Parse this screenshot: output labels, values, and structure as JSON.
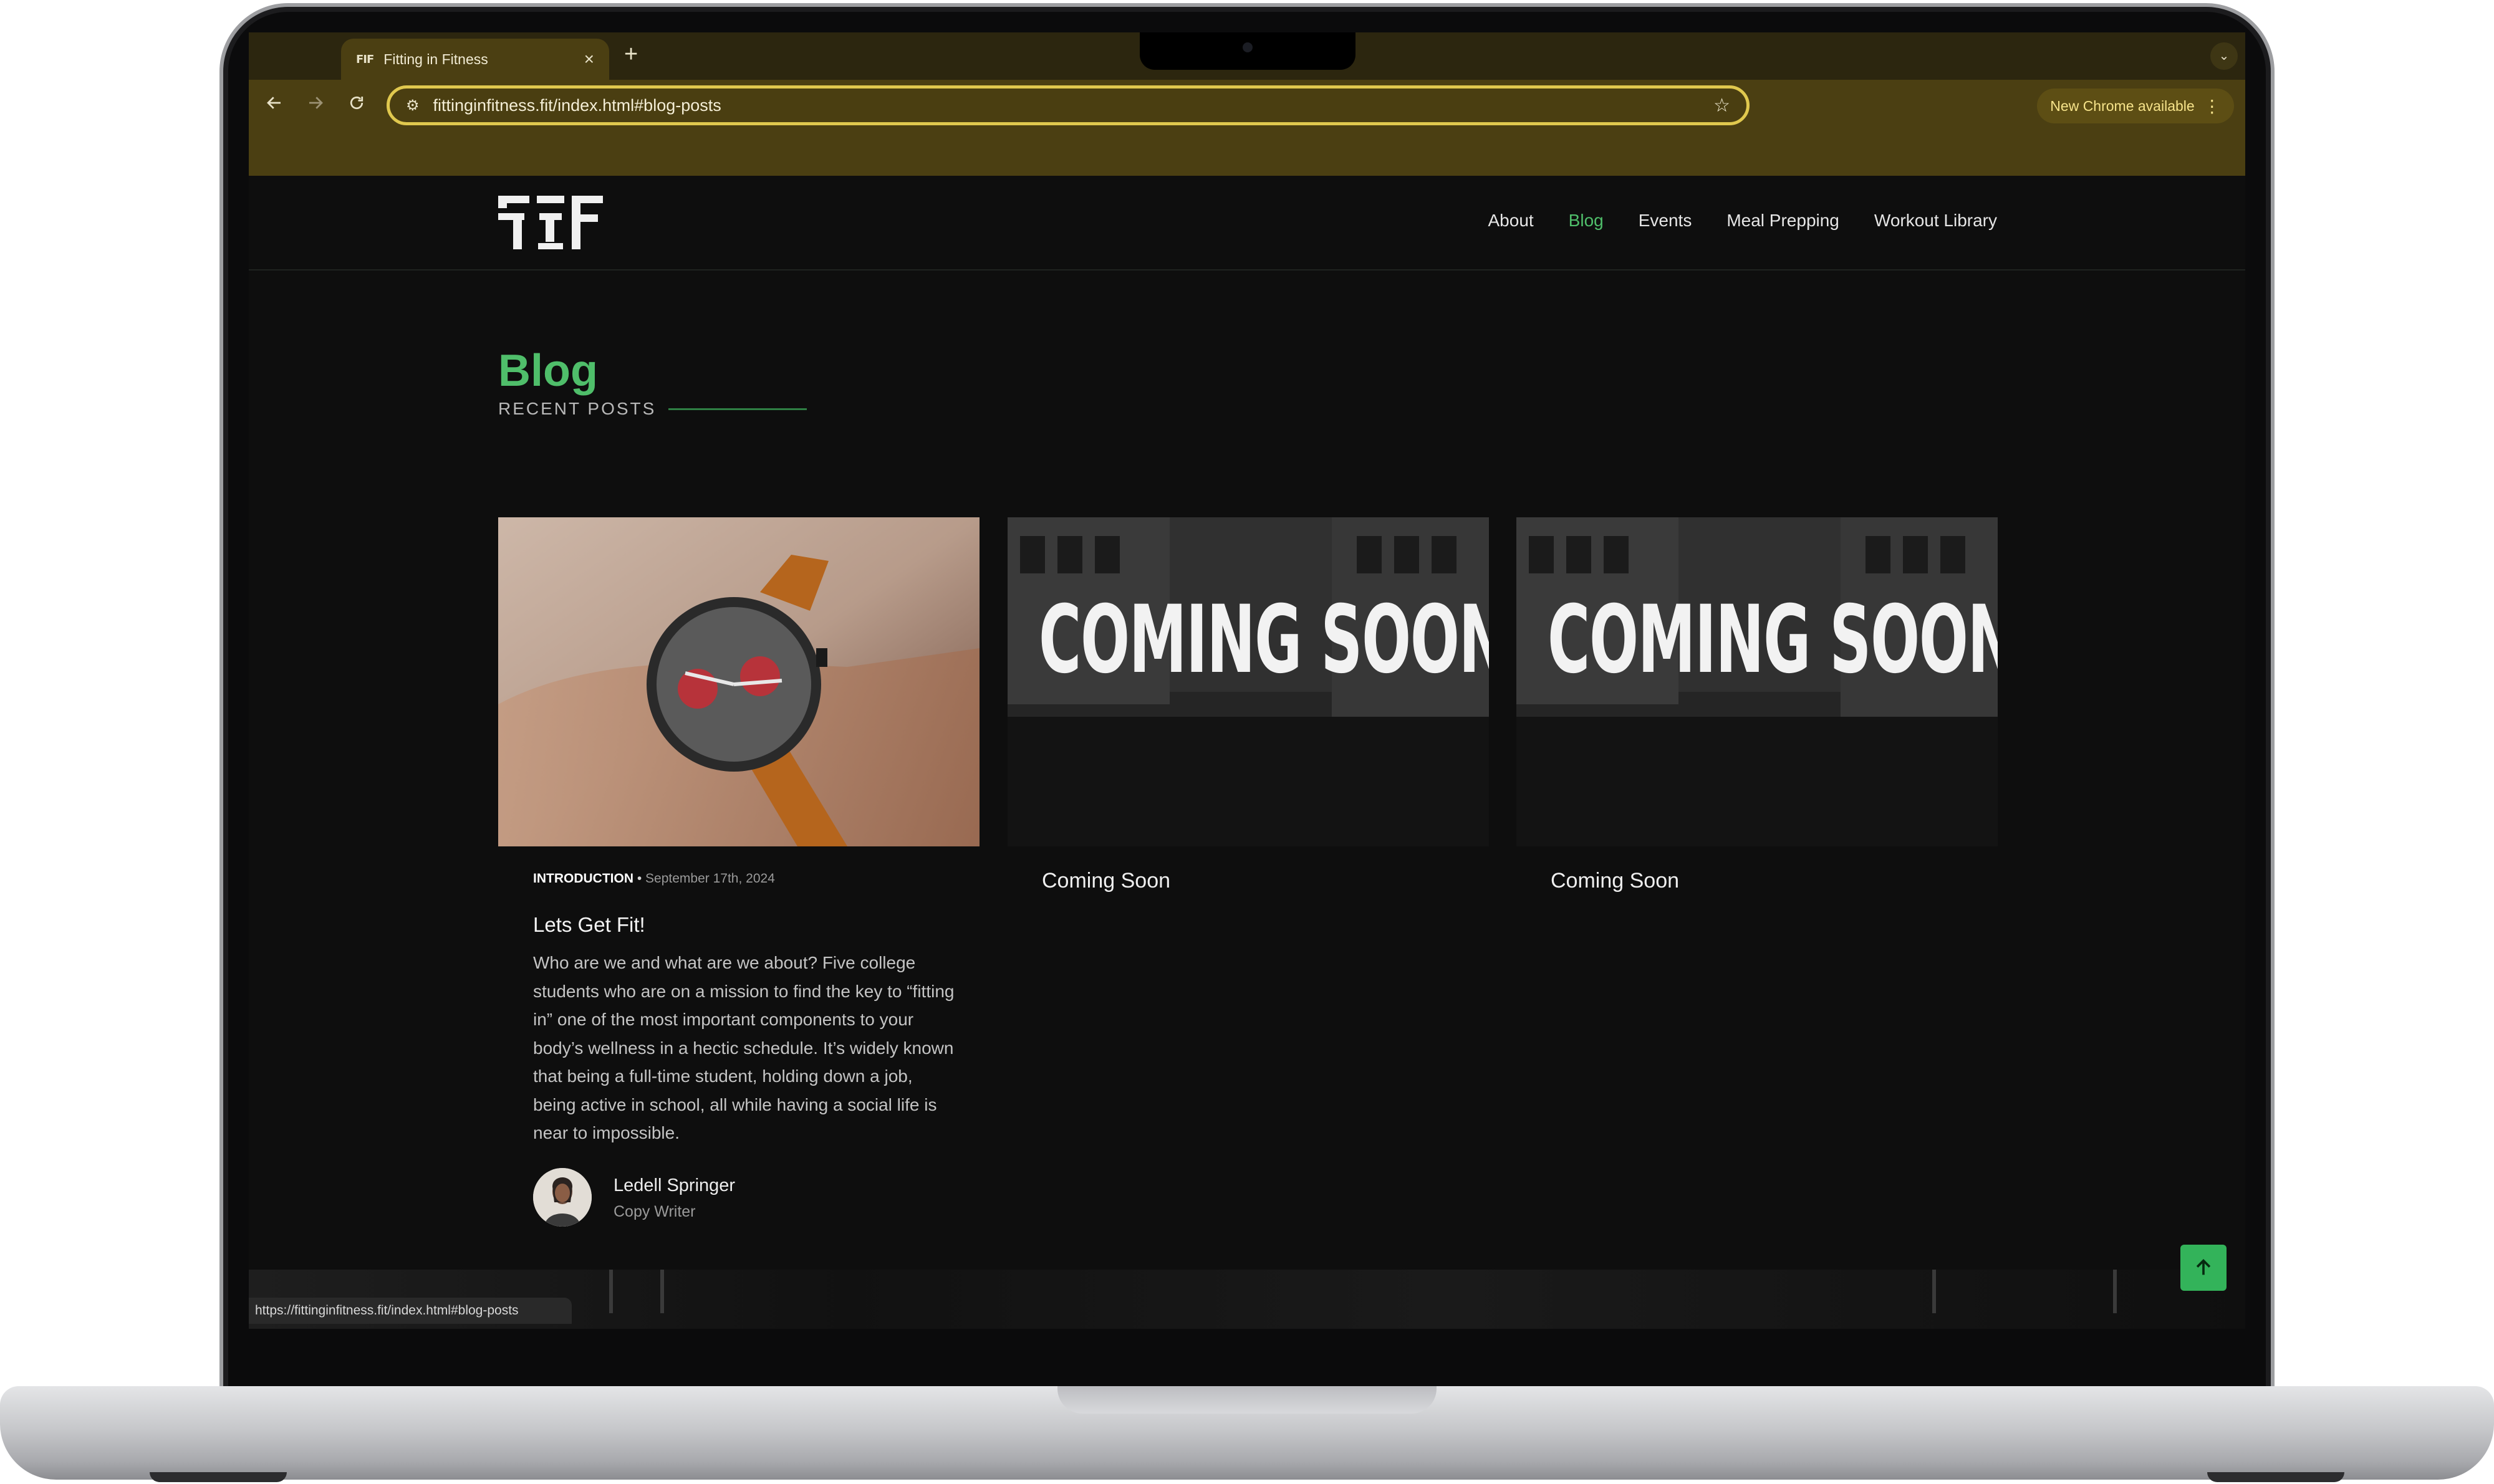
{
  "browser": {
    "tab_title": "Fitting in Fitness",
    "tab_favicon": "FIF logo",
    "new_tab_symbol": "+",
    "url": "fittinginfitness.fit/index.html#blog-posts",
    "update_label": "New Chrome available",
    "status_url": "https://fittinginfitness.fit/index.html#blog-posts"
  },
  "site": {
    "logo_text": "FIF",
    "nav": [
      {
        "label": "About",
        "active": false
      },
      {
        "label": "Blog",
        "active": true
      },
      {
        "label": "Events",
        "active": false
      },
      {
        "label": "Meal Prepping",
        "active": false
      },
      {
        "label": "Workout Library",
        "active": false
      }
    ]
  },
  "blog": {
    "title": "Blog",
    "subtitle": "RECENT POSTS",
    "posts": [
      {
        "category": "INTRODUCTION",
        "separator": "•",
        "date": "September 17th, 2024",
        "title": "Lets Get Fit!",
        "excerpt": "Who are we and what are we about? Five college students who are on a mission to find the key to “fitting in” one of the most important components to your body’s wellness in a hectic schedule. It’s widely known that being a full-time student, holding down a job, being active in school, all while having a social life is near to impossible.",
        "author": "Ledell Springer",
        "author_role": "Copy Writer",
        "image": "wristwatch photo"
      },
      {
        "title": "Coming Soon",
        "image_text": "COMING SOON"
      },
      {
        "title": "Coming Soon",
        "image_text": "COMING SOON"
      }
    ]
  },
  "colors": {
    "accent_green": "#4fbe6a",
    "chrome_toolbar": "#4b3f12",
    "omnibox_border": "#e0c84e",
    "page_bg": "#0e0e0e"
  },
  "icons": {
    "back": "arrow-left-icon",
    "forward": "arrow-right-icon",
    "reload": "reload-icon",
    "site_info": "tune-icon",
    "bookmark": "star-icon",
    "scroll_top": "arrow-up-icon"
  }
}
